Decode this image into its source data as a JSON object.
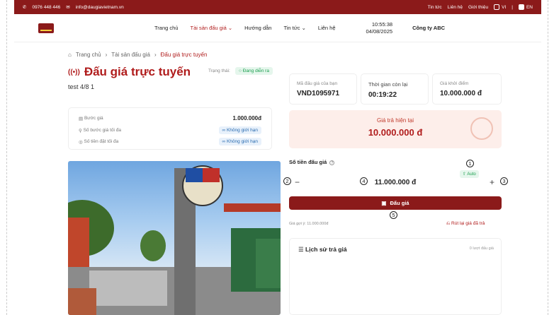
{
  "topbar": {
    "phone": "0976 448 446",
    "email": "info@daugiavietnam.vn",
    "links": [
      "Tin tức",
      "Liên hệ",
      "Giới thiệu"
    ],
    "lang_vi": "VI",
    "lang_en": "EN"
  },
  "nav": {
    "items": [
      "Trang chủ",
      "Tài sản đấu giá ⌄",
      "Hướng dẫn",
      "Tin tức ⌄",
      "Liên hệ"
    ],
    "time": "10:55:38",
    "date": "04/08/2025",
    "company": "Công ty ABC"
  },
  "breadcrumb": [
    "Trang chủ",
    "Tài sản đấu giá",
    "Đấu giá trực tuyến"
  ],
  "header": {
    "title": "Đấu giá trực tuyến",
    "status_label": "Trạng thái:",
    "status": "Đang diễn ra",
    "subtitle": "test 4/8 1"
  },
  "details": [
    {
      "label": "Bước giá",
      "value": "1.000.000đ"
    },
    {
      "label": "Số bước giá tối đa",
      "value": "Không giới hạn"
    },
    {
      "label": "Số tiền đặt tối đa",
      "value": "Không giới hạn"
    }
  ],
  "cards": {
    "code_label": "Mã đấu giá của bạn",
    "code": "VND1095971",
    "time_label": "Thời gian còn lại",
    "time": "00:19:22",
    "start_label": "Giá khởi điểm",
    "start": "10.000.000 đ"
  },
  "current": {
    "label": "Giá trả hiện tại",
    "value": "10.000.000 đ"
  },
  "bid": {
    "label": "Số tiền đấu giá",
    "auto": "Auto",
    "value": "11.000.000 đ",
    "minus": "−",
    "plus": "+",
    "button": "Đấu giá",
    "suggest": "Giá gợi ý: 11.000.000đ",
    "withdraw": "Rút lại giá đã trả"
  },
  "history": {
    "title": "Lịch sử trả giá",
    "count": "0 lượt đấu giá"
  },
  "markers": [
    "1",
    "2",
    "3",
    "4",
    "5"
  ]
}
